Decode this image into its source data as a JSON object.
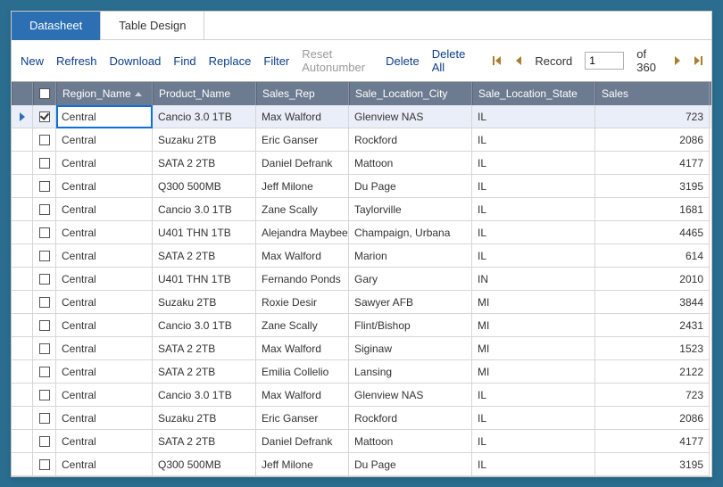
{
  "tabs": {
    "datasheet": "Datasheet",
    "tableDesign": "Table Design"
  },
  "toolbar": {
    "new": "New",
    "refresh": "Refresh",
    "download": "Download",
    "find": "Find",
    "replace": "Replace",
    "filter": "Filter",
    "resetAutonumber": "Reset Autonumber",
    "delete": "Delete",
    "deleteAll": "Delete All",
    "recordLabel": "Record",
    "recordValue": "1",
    "recordTotal": "of 360"
  },
  "columns": {
    "region": "Region_Name",
    "product": "Product_Name",
    "rep": "Sales_Rep",
    "city": "Sale_Location_City",
    "state": "Sale_Location_State",
    "sales": "Sales"
  },
  "rows": [
    {
      "checked": true,
      "current": true,
      "region": "Central",
      "product": "Cancio 3.0 1TB",
      "rep": "Max Walford",
      "city": "Glenview NAS",
      "state": "IL",
      "sales": "723"
    },
    {
      "checked": false,
      "current": false,
      "region": "Central",
      "product": "Suzaku 2TB",
      "rep": "Eric Ganser",
      "city": "Rockford",
      "state": "IL",
      "sales": "2086"
    },
    {
      "checked": false,
      "current": false,
      "region": "Central",
      "product": "SATA 2 2TB",
      "rep": "Daniel Defrank",
      "city": "Mattoon",
      "state": "IL",
      "sales": "4177"
    },
    {
      "checked": false,
      "current": false,
      "region": "Central",
      "product": "Q300 500MB",
      "rep": "Jeff Milone",
      "city": "Du Page",
      "state": "IL",
      "sales": "3195"
    },
    {
      "checked": false,
      "current": false,
      "region": "Central",
      "product": "Cancio 3.0 1TB",
      "rep": "Zane Scally",
      "city": "Taylorville",
      "state": "IL",
      "sales": "1681"
    },
    {
      "checked": false,
      "current": false,
      "region": "Central",
      "product": "U401 THN 1TB",
      "rep": "Alejandra Maybee",
      "city": "Champaign, Urbana",
      "state": "IL",
      "sales": "4465"
    },
    {
      "checked": false,
      "current": false,
      "region": "Central",
      "product": "SATA 2 2TB",
      "rep": "Max Walford",
      "city": "Marion",
      "state": "IL",
      "sales": "614"
    },
    {
      "checked": false,
      "current": false,
      "region": "Central",
      "product": "U401 THN 1TB",
      "rep": "Fernando Ponds",
      "city": "Gary",
      "state": "IN",
      "sales": "2010"
    },
    {
      "checked": false,
      "current": false,
      "region": "Central",
      "product": "Suzaku 2TB",
      "rep": "Roxie Desir",
      "city": "Sawyer AFB",
      "state": "MI",
      "sales": "3844"
    },
    {
      "checked": false,
      "current": false,
      "region": "Central",
      "product": "Cancio 3.0 1TB",
      "rep": "Zane Scally",
      "city": "Flint/Bishop",
      "state": "MI",
      "sales": "2431"
    },
    {
      "checked": false,
      "current": false,
      "region": "Central",
      "product": "SATA 2 2TB",
      "rep": "Max Walford",
      "city": "Siginaw",
      "state": "MI",
      "sales": "1523"
    },
    {
      "checked": false,
      "current": false,
      "region": "Central",
      "product": "SATA 2 2TB",
      "rep": "Emilia Collelio",
      "city": "Lansing",
      "state": "MI",
      "sales": "2122"
    },
    {
      "checked": false,
      "current": false,
      "region": "Central",
      "product": "Cancio 3.0 1TB",
      "rep": "Max Walford",
      "city": "Glenview NAS",
      "state": "IL",
      "sales": "723"
    },
    {
      "checked": false,
      "current": false,
      "region": "Central",
      "product": "Suzaku 2TB",
      "rep": "Eric Ganser",
      "city": "Rockford",
      "state": "IL",
      "sales": "2086"
    },
    {
      "checked": false,
      "current": false,
      "region": "Central",
      "product": "SATA 2 2TB",
      "rep": "Daniel Defrank",
      "city": "Mattoon",
      "state": "IL",
      "sales": "4177"
    },
    {
      "checked": false,
      "current": false,
      "region": "Central",
      "product": "Q300 500MB",
      "rep": "Jeff Milone",
      "city": "Du Page",
      "state": "IL",
      "sales": "3195"
    }
  ]
}
